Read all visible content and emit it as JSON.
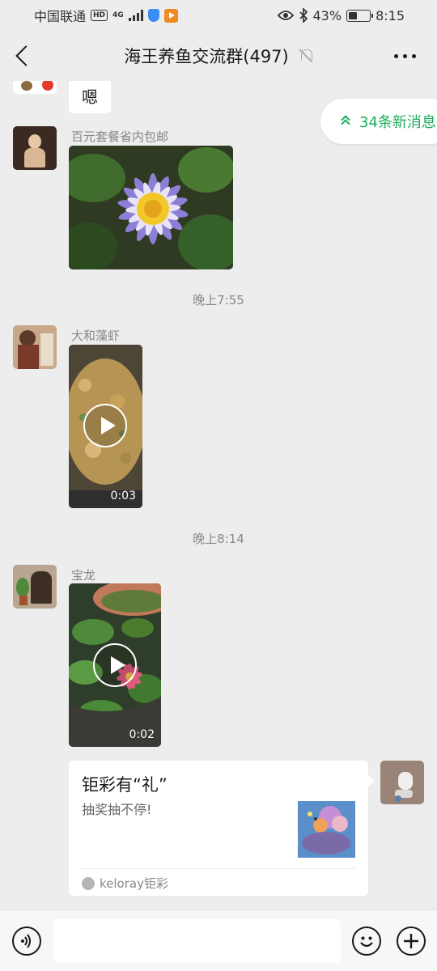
{
  "status_bar": {
    "carrier": "中国联通",
    "hd_badge": "HD",
    "network_type": "4G",
    "battery_text": "43%",
    "time": "8:15"
  },
  "nav": {
    "title": "海王养鱼交流群(497)"
  },
  "new_messages": {
    "label": "34条新消息"
  },
  "messages": [
    {
      "type": "text",
      "text": "嗯"
    },
    {
      "type": "image",
      "sender": "百元套餐省内包邮"
    },
    {
      "type": "time",
      "text": "晚上7:55"
    },
    {
      "type": "video",
      "sender": "大和藻虾",
      "duration": "0:03"
    },
    {
      "type": "time",
      "text": "晚上8:14"
    },
    {
      "type": "video",
      "sender": "宝龙",
      "duration": "0:02"
    },
    {
      "type": "link_card",
      "title": "钜彩有“礼”",
      "desc": "抽奖抽不停!",
      "source": "keloray钜彩"
    }
  ],
  "colors": {
    "background": "#ededed",
    "accent_green": "#1aad5a",
    "bubble": "#ffffff"
  },
  "icons": {
    "back": "back-arrow-icon",
    "mute": "bell-off-icon",
    "more": "more-dots-icon",
    "voice": "voice-icon",
    "emoji": "emoji-icon",
    "plus": "plus-icon"
  }
}
